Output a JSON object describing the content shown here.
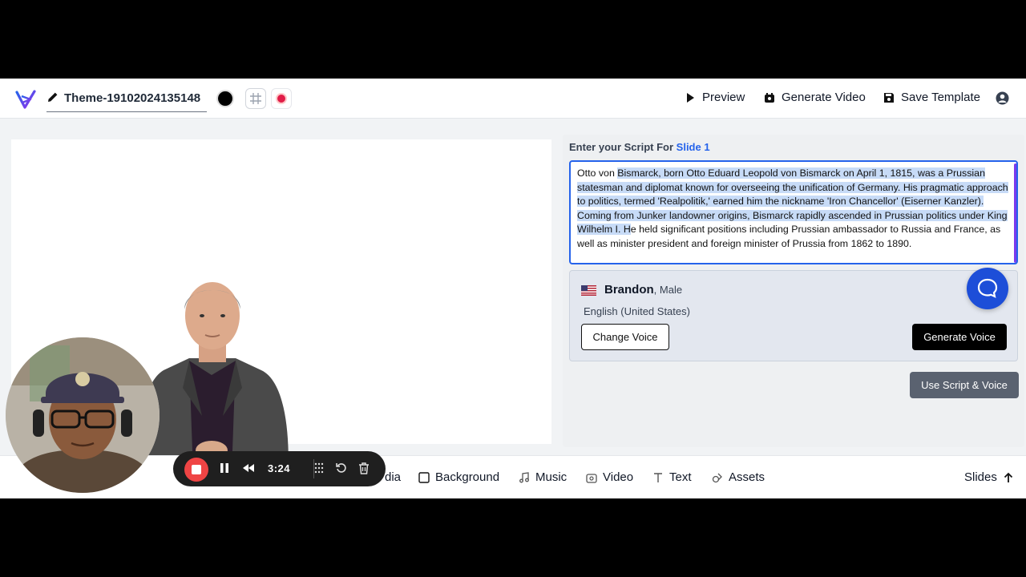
{
  "topbar": {
    "theme_title": "Theme-19102024135148",
    "preview_label": "Preview",
    "generate_video_label": "Generate Video",
    "save_template_label": "Save Template"
  },
  "script_panel": {
    "label_prefix": "Enter your Script For",
    "slide_label": "Slide 1",
    "text_before": "Otto von ",
    "text_selected": "Bismarck, born Otto Eduard Leopold von Bismarck on April 1, 1815, was a Prussian statesman and diplomat known for overseeing the unification of Germany. His pragmatic approach to politics, termed 'Realpolitik,' earned him the nickname 'Iron Chancellor' (Eiserner Kanzler). Coming from Junker landowner origins, Bismarck rapidly ascended in Prussian politics under King Wilhelm I. H",
    "text_after": "e held significant positions including Prussian ambassador to Russia and France, as well as minister president and foreign minister of Prussia from 1862 to 1890."
  },
  "voice": {
    "name": "Brandon",
    "gender": ", Male",
    "language": "English (United States)",
    "change_label": "Change Voice",
    "generate_label": "Generate Voice",
    "use_label": "Use Script & Voice"
  },
  "bottom_tabs": {
    "media": "dia",
    "background": "Background",
    "music": "Music",
    "video": "Video",
    "text": "Text",
    "assets": "Assets",
    "slides": "Slides"
  },
  "recorder": {
    "time": "3:24"
  },
  "colors": {
    "accent_blue": "#2563eb",
    "record_red": "#ef4444",
    "chat_blue": "#1d4ed8"
  }
}
